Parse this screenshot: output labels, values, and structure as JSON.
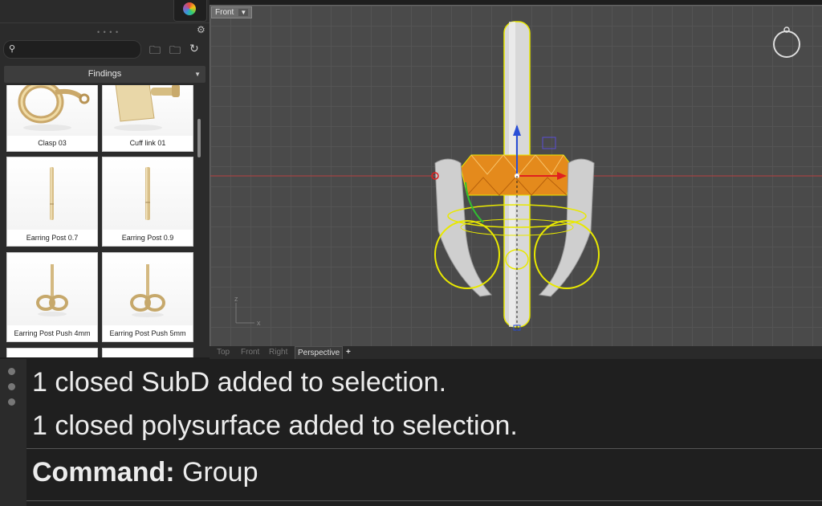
{
  "library": {
    "category": "Findings",
    "search_placeholder": "",
    "items": [
      {
        "label": "Clasp 03"
      },
      {
        "label": "Cuff link 01"
      },
      {
        "label": "Earring Post 0.7"
      },
      {
        "label": "Earring Post 0.9"
      },
      {
        "label": "Earring Post Push 4mm"
      },
      {
        "label": "Earring Post Push 5mm"
      }
    ],
    "icons": [
      "color-wheel-icon",
      "gear-icon",
      "search-icon",
      "folder-back-icon",
      "folder-add-icon",
      "refresh-icon"
    ]
  },
  "viewport": {
    "title": "Front",
    "axis_x": "x",
    "axis_z": "z",
    "tabs": [
      "Top",
      "Front",
      "Right",
      "Perspective"
    ],
    "active_tab": "Perspective",
    "add_tab": "+"
  },
  "command": {
    "history": [
      "1 closed SubD added to selection.",
      "1 closed polysurface added to selection."
    ],
    "prompt_label": "Command:",
    "prompt_value": " Group"
  },
  "colors": {
    "selection": "#e8e800",
    "x_axis": "#d63030",
    "gem": "#e48a1c",
    "gizmo_z": "#2a4fd6"
  }
}
